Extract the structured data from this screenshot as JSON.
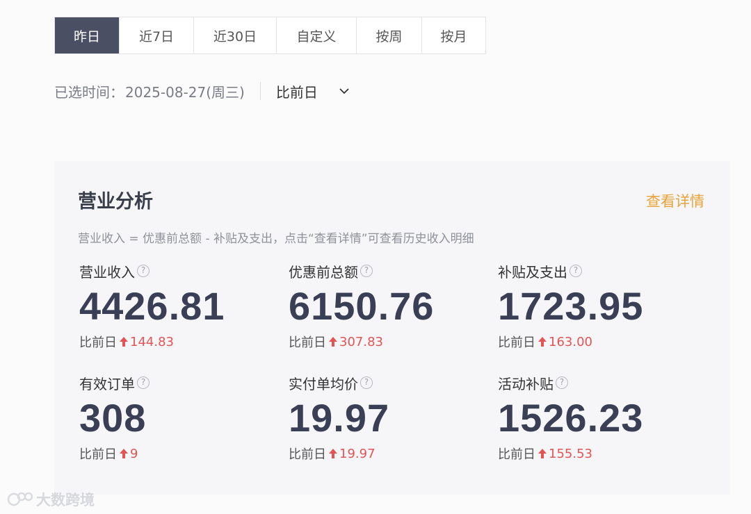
{
  "tabs": [
    {
      "label": "昨日",
      "active": true
    },
    {
      "label": "近7日",
      "active": false
    },
    {
      "label": "近30日",
      "active": false
    },
    {
      "label": "自定义",
      "active": false
    },
    {
      "label": "按周",
      "active": false
    },
    {
      "label": "按月",
      "active": false
    }
  ],
  "date_row": {
    "label": "已选时间：",
    "value": "2025-08-27(周三)",
    "compare_option": "比前日",
    "chevron_icon": "chevron-down-icon"
  },
  "card": {
    "title": "营业分析",
    "detail_link": "查看详情",
    "formula": "营业收入 = 优惠前总额 - 补贴及支出，点击“查看详情”可查看历史收入明细",
    "metrics": [
      {
        "label": "营业收入",
        "value": "4426.81",
        "compare_label": "比前日",
        "change": "144.83",
        "trend": "up"
      },
      {
        "label": "优惠前总额",
        "value": "6150.76",
        "compare_label": "比前日",
        "change": "307.83",
        "trend": "up"
      },
      {
        "label": "补贴及支出",
        "value": "1723.95",
        "compare_label": "比前日",
        "change": "163.00",
        "trend": "up"
      },
      {
        "label": "有效订单",
        "value": "308",
        "compare_label": "比前日",
        "change": "9",
        "trend": "up"
      },
      {
        "label": "实付单均价",
        "value": "19.97",
        "compare_label": "比前日",
        "change": "19.97",
        "trend": "up"
      },
      {
        "label": "活动补贴",
        "value": "1526.23",
        "compare_label": "比前日",
        "change": "155.53",
        "trend": "up"
      }
    ],
    "help_icon_glyph": "?"
  },
  "watermark": {
    "text": "大数跨境",
    "logo_icon": "brand-logo-icon"
  },
  "colors": {
    "active_tab": "#4a4f63",
    "accent_link": "#e8a43a",
    "trend_up": "#e45454",
    "value_text": "#3a3f55"
  }
}
